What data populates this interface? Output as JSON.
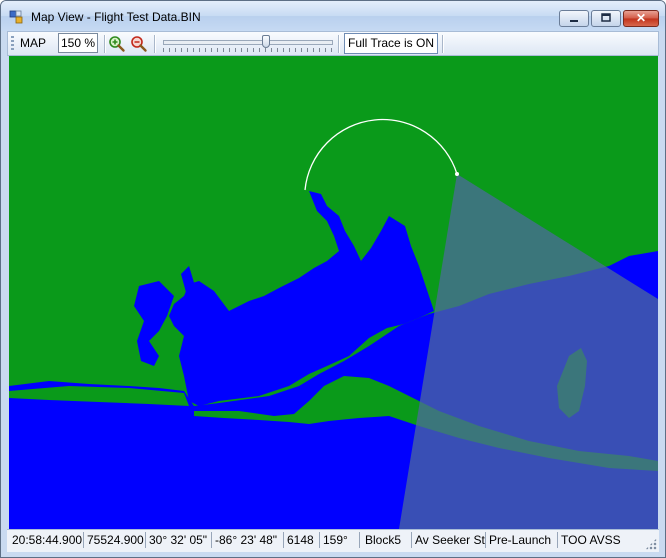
{
  "window": {
    "title": "Map View - Flight Test Data.BIN",
    "controls": {
      "minimize": "minimize-icon",
      "maximize": "maximize-icon",
      "close": "close-icon",
      "close_glyph": "✕"
    }
  },
  "toolbar": {
    "map_label": "MAP",
    "zoom_value": "150 %",
    "zoom_in_icon": "zoom-in-icon",
    "zoom_out_icon": "zoom-out-icon",
    "slider_level": 0.62,
    "trace_button": "Full Trace is ON"
  },
  "map": {
    "colors": {
      "land": "#0a9a1a",
      "water": "#0000ff",
      "seeker_cone": "#4c6a9c",
      "trace": "#ffffff"
    }
  },
  "status": {
    "time": "20:58:44.900",
    "seconds": "75524.900",
    "latitude": "30° 32' 05\"",
    "longitude": "-86° 23' 48\"",
    "altitude": "6148",
    "heading": "159°",
    "block": "Block5",
    "seeker_mode": "Av Seeker St",
    "phase": "Pre-Launch",
    "mode": "TOO AVSS"
  }
}
